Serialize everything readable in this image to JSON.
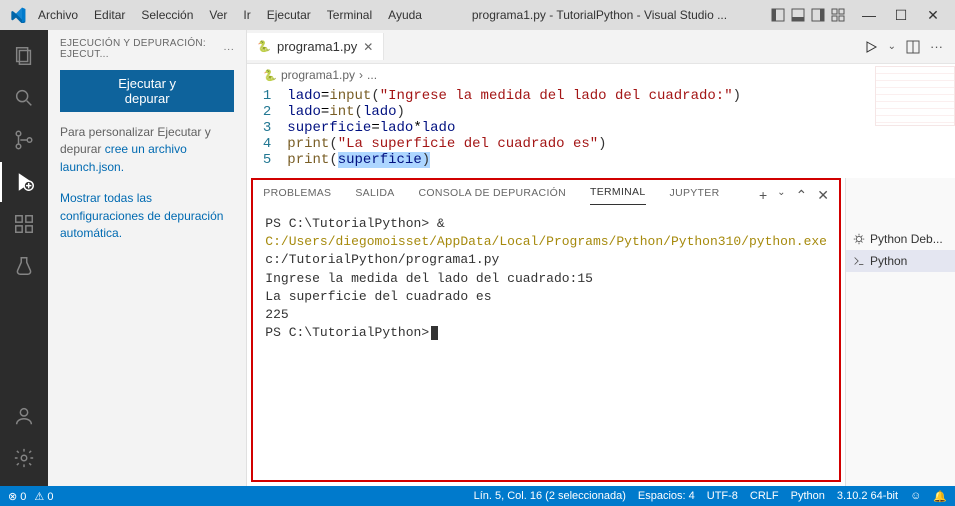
{
  "menu": {
    "archivo": "Archivo",
    "editar": "Editar",
    "seleccion": "Selección",
    "ver": "Ver",
    "ir": "Ir",
    "ejecutar": "Ejecutar",
    "terminal": "Terminal",
    "ayuda": "Ayuda"
  },
  "window_title": "programa1.py - TutorialPython - Visual Studio ...",
  "sidebar": {
    "header": "EJECUCIÓN Y DEPURACIÓN: EJECUT...",
    "run_button": "Ejecutar y depurar",
    "customize_text": "Para personalizar Ejecutar y depurar",
    "customize_link": "cree un archivo launch.json.",
    "showall_link": "Mostrar todas las configuraciones de depuración automática."
  },
  "tab": {
    "name": "programa1.py"
  },
  "breadcrumb": {
    "file": "programa1.py",
    "sep": "›",
    "more": "..."
  },
  "code": {
    "l1": {
      "n": "1",
      "v1": "lado",
      "op1": "=",
      "fn": "input",
      "p1": "(",
      "str": "\"Ingrese la medida del lado del cuadrado:\"",
      "p2": ")"
    },
    "l2": {
      "n": "2",
      "v1": "lado",
      "op1": "=",
      "fn": "int",
      "p1": "(",
      "v2": "lado",
      "p2": ")"
    },
    "l3": {
      "n": "3",
      "v1": "superficie",
      "op1": "=",
      "v2": "lado",
      "op2": "*",
      "v3": "lado"
    },
    "l4": {
      "n": "4",
      "fn": "print",
      "p1": "(",
      "str": "\"La superficie del cuadrado es\"",
      "p2": ")"
    },
    "l5": {
      "n": "5",
      "fn": "print",
      "p1": "(",
      "v1": "superficie",
      "p2": ")"
    }
  },
  "panel": {
    "tabs": {
      "problemas": "PROBLEMAS",
      "salida": "SALIDA",
      "consola": "CONSOLA DE DEPURACIÓN",
      "terminal": "TERMINAL",
      "jupyter": "JUPYTER"
    },
    "term": {
      "p1a": "PS C:\\TutorialPython> & ",
      "p1b": "C:/Users/diegomoisset/AppData/Local/Programs/Python/Python310/python.exe",
      "p1c": " c:/TutorialPython/programa1.py",
      "p2": "Ingrese la medida del lado del cuadrado:15",
      "p3": "La superficie del cuadrado es",
      "p4": "225",
      "p5": "PS C:\\TutorialPython>"
    }
  },
  "right": {
    "item1": "Python Deb...",
    "item2": "Python"
  },
  "status": {
    "errors": "0",
    "warnings": "0",
    "line_col": "Lín. 5, Col. 16 (2 seleccionada)",
    "spaces": "Espacios: 4",
    "encoding": "UTF-8",
    "eol": "CRLF",
    "lang": "Python",
    "version": "3.10.2 64-bit"
  }
}
